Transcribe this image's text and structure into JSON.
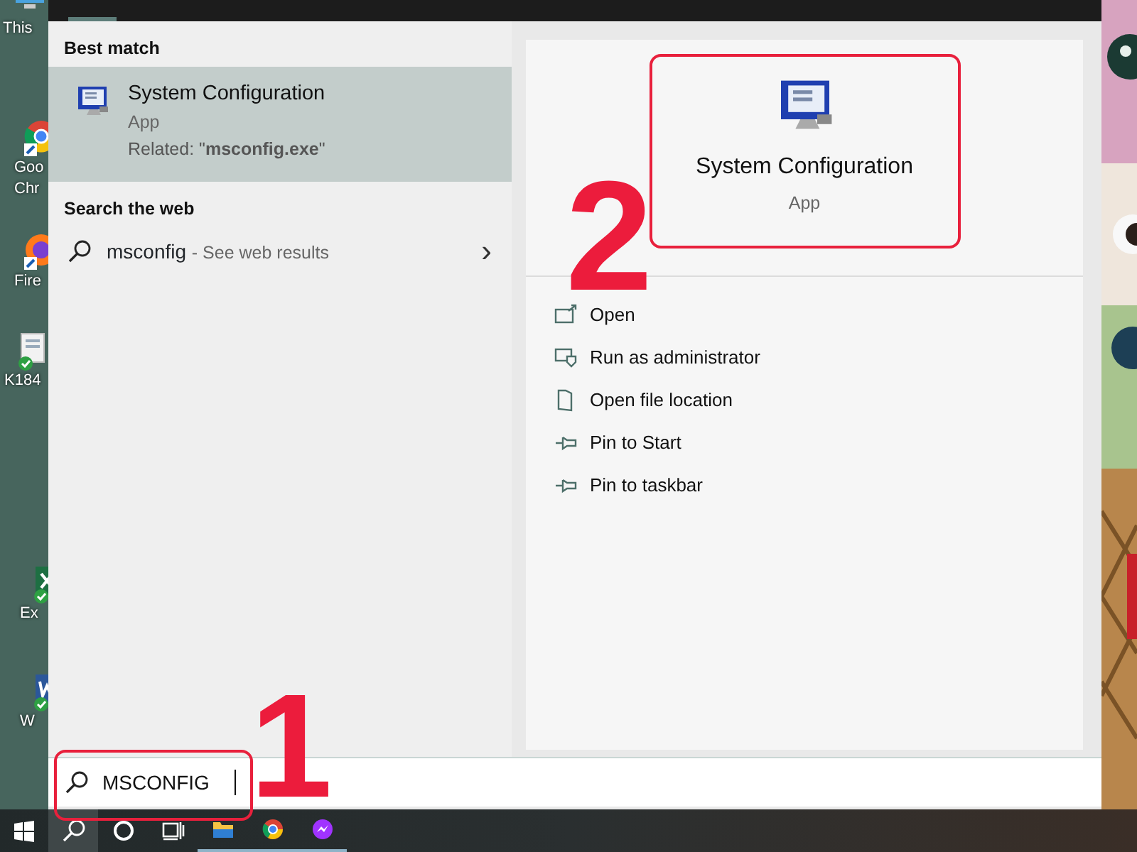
{
  "desktop_icons": [
    {
      "kind": "pc",
      "labels": [
        "This"
      ]
    },
    {
      "kind": "chrome",
      "labels": [
        "Goo",
        "Chr"
      ]
    },
    {
      "kind": "firefox",
      "labels": [
        "Fire"
      ]
    },
    {
      "kind": "document",
      "labels": [
        "K184"
      ]
    },
    {
      "kind": "excel",
      "labels": [
        "Ex"
      ]
    },
    {
      "kind": "word",
      "labels": [
        "W"
      ]
    }
  ],
  "results": {
    "best_match_heading": "Best match",
    "best_match": {
      "title": "System Configuration",
      "type": "App",
      "related": "Related: \"**msconfig.exe**\"",
      "selected": true
    },
    "web_heading": "Search the web",
    "web_result": {
      "query": "msconfig",
      "hint": "- See web results",
      "chevron": "›"
    }
  },
  "preview": {
    "title": "System Configuration",
    "type": "App",
    "actions": [
      {
        "kind": "open",
        "label": "Open"
      },
      {
        "kind": "admin",
        "label": "Run as administrator"
      },
      {
        "kind": "folder",
        "label": "Open file location"
      },
      {
        "kind": "pin",
        "label": "Pin to Start"
      },
      {
        "kind": "pin",
        "label": "Pin to taskbar"
      }
    ]
  },
  "search_box": {
    "value": "MSCONFIG"
  },
  "taskbar": [
    {
      "kind": "start",
      "selected": false,
      "running": false
    },
    {
      "kind": "search",
      "selected": true,
      "running": false
    },
    {
      "kind": "cortana",
      "selected": false,
      "running": false
    },
    {
      "kind": "taskview",
      "selected": false,
      "running": false
    },
    {
      "kind": "explorer",
      "selected": false,
      "running": true
    },
    {
      "kind": "chrome",
      "selected": false,
      "running": true
    },
    {
      "kind": "messenger",
      "selected": false,
      "running": true
    }
  ],
  "annotations": [
    {
      "number": "1"
    },
    {
      "number": "2"
    }
  ]
}
